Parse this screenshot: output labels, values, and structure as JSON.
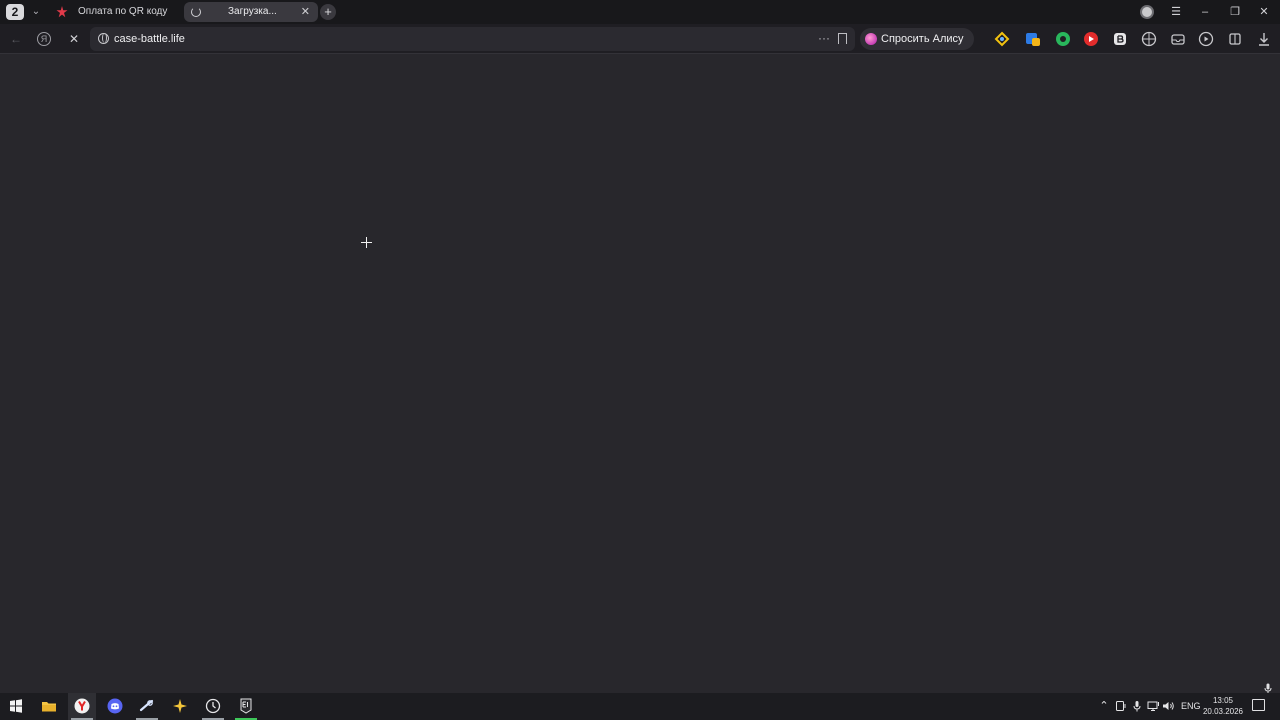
{
  "browser": {
    "tab_count": "2",
    "tabs": [
      {
        "title": "Оплата по QR коду"
      },
      {
        "title": "Загрузка..."
      }
    ],
    "address": {
      "url": "case-battle.life",
      "more": "···"
    },
    "alice_button": "Спросить Алису AI",
    "accent": "#c63fb5",
    "window_controls": {
      "menu": "☰",
      "minimize": "–",
      "restore": "❐",
      "close": "✕"
    }
  },
  "taskbar": {
    "apps": [
      {
        "icon": "windows-start-icon"
      },
      {
        "icon": "file-explorer-icon"
      },
      {
        "icon": "yandex-browser-icon"
      },
      {
        "icon": "discord-icon"
      },
      {
        "icon": "steam-icon"
      },
      {
        "icon": "game-launcher-icon"
      },
      {
        "icon": "clock-app-icon"
      },
      {
        "icon": "epic-games-icon"
      }
    ],
    "language": "ENG",
    "time": "13:05",
    "date": "20.03.2026"
  }
}
